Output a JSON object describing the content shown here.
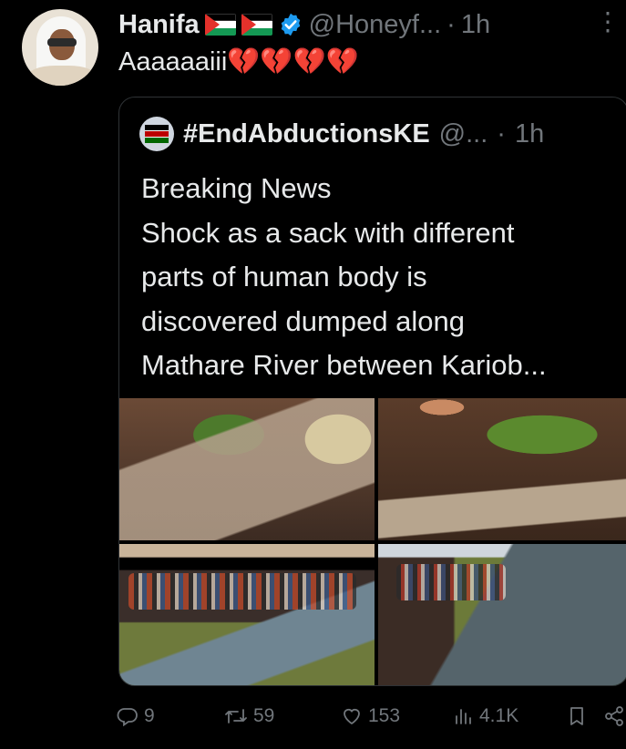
{
  "author": {
    "name": "Hanifa",
    "handle": "@Honeyf...",
    "dot": "·",
    "time": "1h",
    "flags": [
      "palestine-flag",
      "palestine-flag"
    ],
    "verified_icon": "verified-badge-icon"
  },
  "tweet": {
    "text": "Aaaaaaiii💔💔💔💔"
  },
  "quote": {
    "name": "#EndAbductionsKE",
    "handle": "@...",
    "dot": "·",
    "time": "1h",
    "lines": [
      "Breaking News",
      "Shock as a sack with different",
      "parts of human body  is",
      "discovered  dumped along",
      "Mathare River between Kariob..."
    ]
  },
  "media": [
    "photo-sack-ground",
    "photo-cloth-plants",
    "photo-crowd-river-left",
    "photo-crowd-river-right"
  ],
  "actions": {
    "replies": "9",
    "reposts": "59",
    "likes": "153",
    "views": "4.1K"
  },
  "colors": {
    "background": "#000000",
    "text": "#e7e9ea",
    "muted": "#71767b",
    "verified": "#1d9bf0",
    "border": "#2f3336",
    "broken_heart": "#f4355b"
  }
}
